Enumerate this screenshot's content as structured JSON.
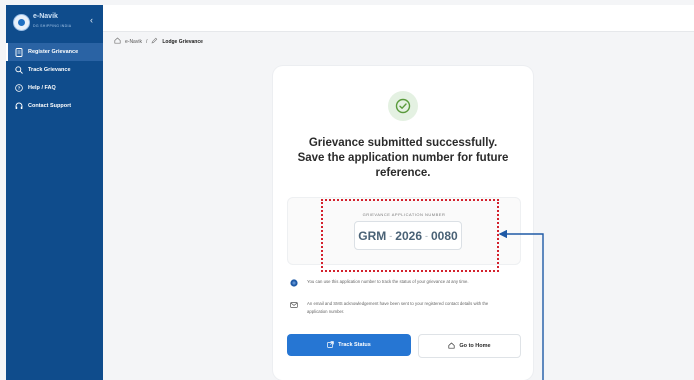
{
  "sidebar": {
    "brand_name": "e-Navik",
    "brand_sub": "DG SHIPPING INDIA",
    "items": [
      {
        "label": "Register Grievance",
        "icon": "document-icon",
        "active": true
      },
      {
        "label": "Track Grievance",
        "icon": "search-icon"
      },
      {
        "label": "Help / FAQ",
        "icon": "help-icon"
      },
      {
        "label": "Contact Support",
        "icon": "headset-icon"
      }
    ]
  },
  "breadcrumb": {
    "root": "e-Navik",
    "separator": "/",
    "current": "Lodge Grievance"
  },
  "success": {
    "headline_line1": "Grievance submitted successfully.",
    "headline_line2": "Save the application number for future",
    "headline_line3": "reference.",
    "app_label": "GRIEVANCE APPLICATION NUMBER",
    "app_parts": [
      "GRM",
      "2026",
      "0080"
    ],
    "app_sep": "-",
    "note1": "You can use this application number to track the status of your grievance at any time.",
    "note2": "An email and SMS acknowledgement have been sent to your registered contact details with the application number.",
    "track_button": "Track Status",
    "home_button": "Go to Home"
  },
  "colors": {
    "sidebar": "#0f4c8c",
    "primary": "#2676d3",
    "success": "#5a9a3c",
    "highlight": "#d3212d",
    "arrow": "#1f5aa6"
  }
}
